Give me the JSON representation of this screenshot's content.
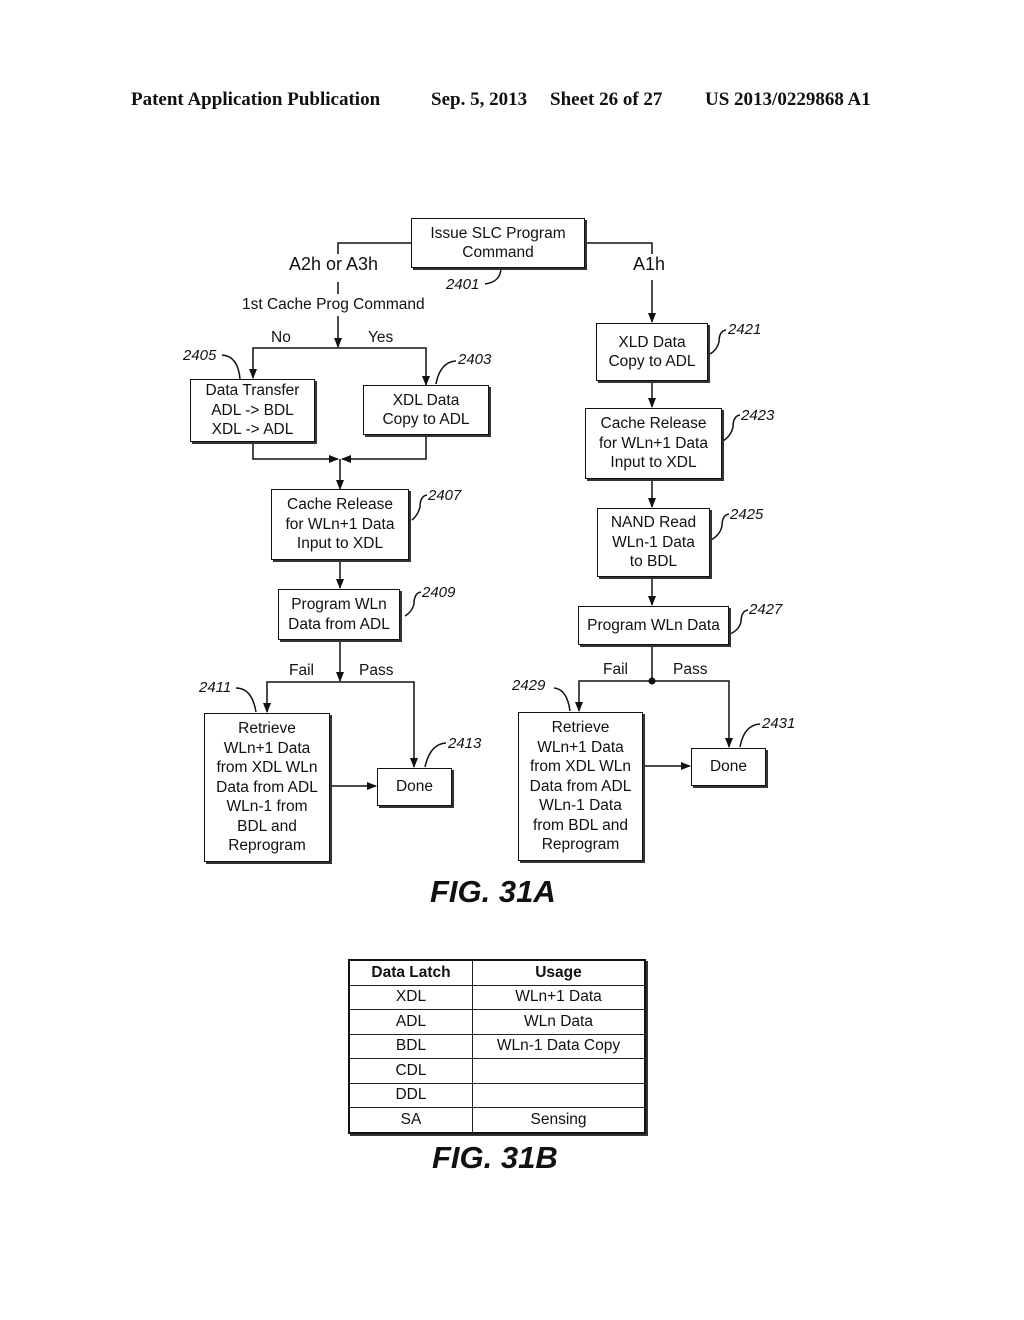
{
  "header": {
    "publication": "Patent Application Publication",
    "date": "Sep. 5, 2013",
    "sheet": "Sheet 26 of 27",
    "number": "US 2013/0229868 A1"
  },
  "fig31a": {
    "caption": "FIG. 31A",
    "nodes": {
      "n2401": {
        "text": "Issue SLC Program\nCommand",
        "ref": "2401"
      },
      "n2403": {
        "text": "XDL Data\nCopy to ADL",
        "ref": "2403"
      },
      "n2405": {
        "text": "Data Transfer\nADL -> BDL\nXDL -> ADL",
        "ref": "2405"
      },
      "n2407": {
        "text": "Cache Release\nfor WLn+1 Data\nInput to XDL",
        "ref": "2407"
      },
      "n2409": {
        "text": "Program WLn\nData from ADL",
        "ref": "2409"
      },
      "n2411": {
        "text": "Retrieve\nWLn+1 Data\nfrom XDL WLn\nData from ADL\nWLn-1 from\nBDL and\nReprogram",
        "ref": "2411"
      },
      "n2413": {
        "text": "Done",
        "ref": "2413"
      },
      "n2421": {
        "text": "XLD Data\nCopy to ADL",
        "ref": "2421"
      },
      "n2423": {
        "text": "Cache Release\nfor WLn+1 Data\nInput to XDL",
        "ref": "2423"
      },
      "n2425": {
        "text": "NAND Read\nWLn-1 Data\nto BDL",
        "ref": "2425"
      },
      "n2427": {
        "text": "Program WLn Data",
        "ref": "2427"
      },
      "n2429": {
        "text": "Retrieve\nWLn+1 Data\nfrom XDL WLn\nData from ADL\nWLn-1 Data\nfrom BDL and\nReprogram",
        "ref": "2429"
      },
      "n2431": {
        "text": "Done",
        "ref": "2431"
      }
    },
    "labels": {
      "a2h_a3h": "A2h or A3h",
      "a1h": "A1h",
      "first_cache": "1st Cache Prog Command",
      "no": "No",
      "yes": "Yes",
      "fail_left": "Fail",
      "pass_left": "Pass",
      "fail_right": "Fail",
      "pass_right": "Pass"
    }
  },
  "fig31b": {
    "caption": "FIG. 31B",
    "columns": [
      "Data Latch",
      "Usage"
    ],
    "rows": [
      [
        "XDL",
        "WLn+1 Data"
      ],
      [
        "ADL",
        "WLn Data"
      ],
      [
        "BDL",
        "WLn-1 Data Copy"
      ],
      [
        "CDL",
        ""
      ],
      [
        "DDL",
        ""
      ],
      [
        "SA",
        "Sensing"
      ]
    ]
  }
}
